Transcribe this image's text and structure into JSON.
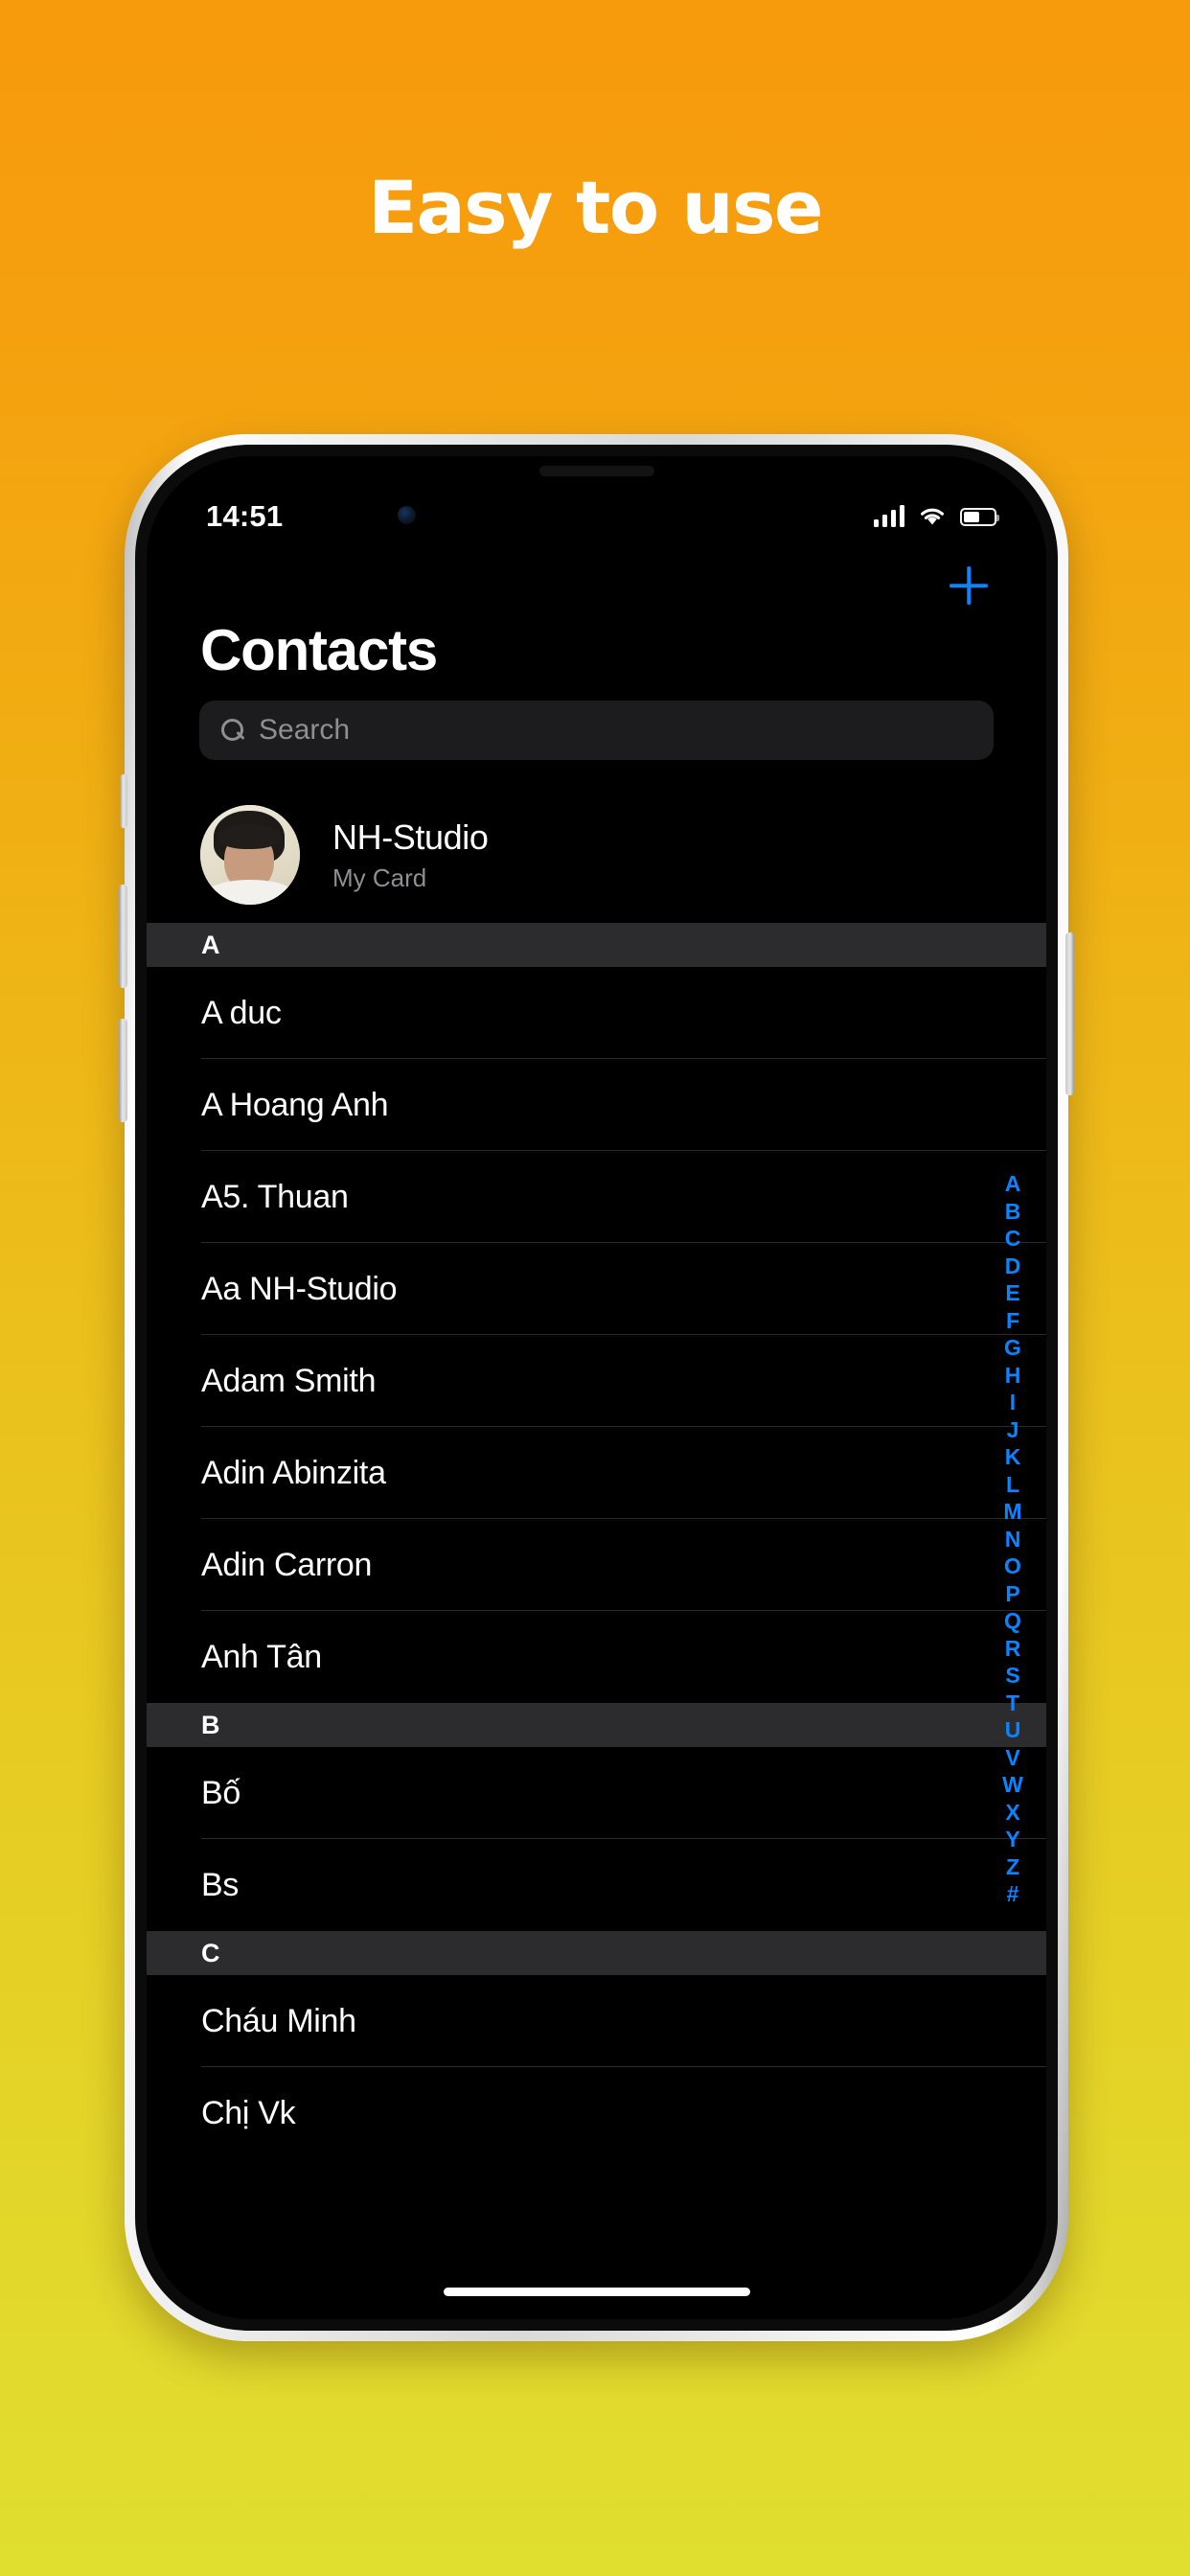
{
  "headline": "Easy to use",
  "theme": {
    "bg_top": "#F79A0C",
    "bg_bottom": "#E0DE2F",
    "accent_blue": "#0A84FF",
    "screen_bg": "#000000",
    "section_header_bg": "#2C2C2E",
    "search_bg": "#1C1C1E",
    "secondary_text": "#8E8E93"
  },
  "status_bar": {
    "time": "14:51",
    "cellular_icon": "cellular-bars-icon",
    "wifi_icon": "wifi-icon",
    "battery_icon": "battery-icon",
    "battery_level": "50"
  },
  "navbar": {
    "add_label": "+",
    "add_icon": "plus-icon"
  },
  "header": {
    "title": "Contacts"
  },
  "search": {
    "placeholder": "Search",
    "value": "",
    "icon": "search-icon"
  },
  "my_card": {
    "name": "NH-Studio",
    "subtitle": "My Card",
    "avatar_icon": "avatar"
  },
  "sections": [
    {
      "letter": "A",
      "contacts": [
        "A duc",
        "A Hoang Anh",
        "A5. Thuan",
        "Aa NH-Studio",
        "Adam Smith",
        "Adin Abinzita",
        "Adin Carron",
        "Anh Tân"
      ]
    },
    {
      "letter": "B",
      "contacts": [
        "Bố",
        "Bs"
      ]
    },
    {
      "letter": "C",
      "contacts": [
        "Cháu Minh",
        "Chị Vk"
      ]
    }
  ],
  "alpha_index": [
    "A",
    "B",
    "C",
    "D",
    "E",
    "F",
    "G",
    "H",
    "I",
    "J",
    "K",
    "L",
    "M",
    "N",
    "O",
    "P",
    "Q",
    "R",
    "S",
    "T",
    "U",
    "V",
    "W",
    "X",
    "Y",
    "Z",
    "#"
  ]
}
